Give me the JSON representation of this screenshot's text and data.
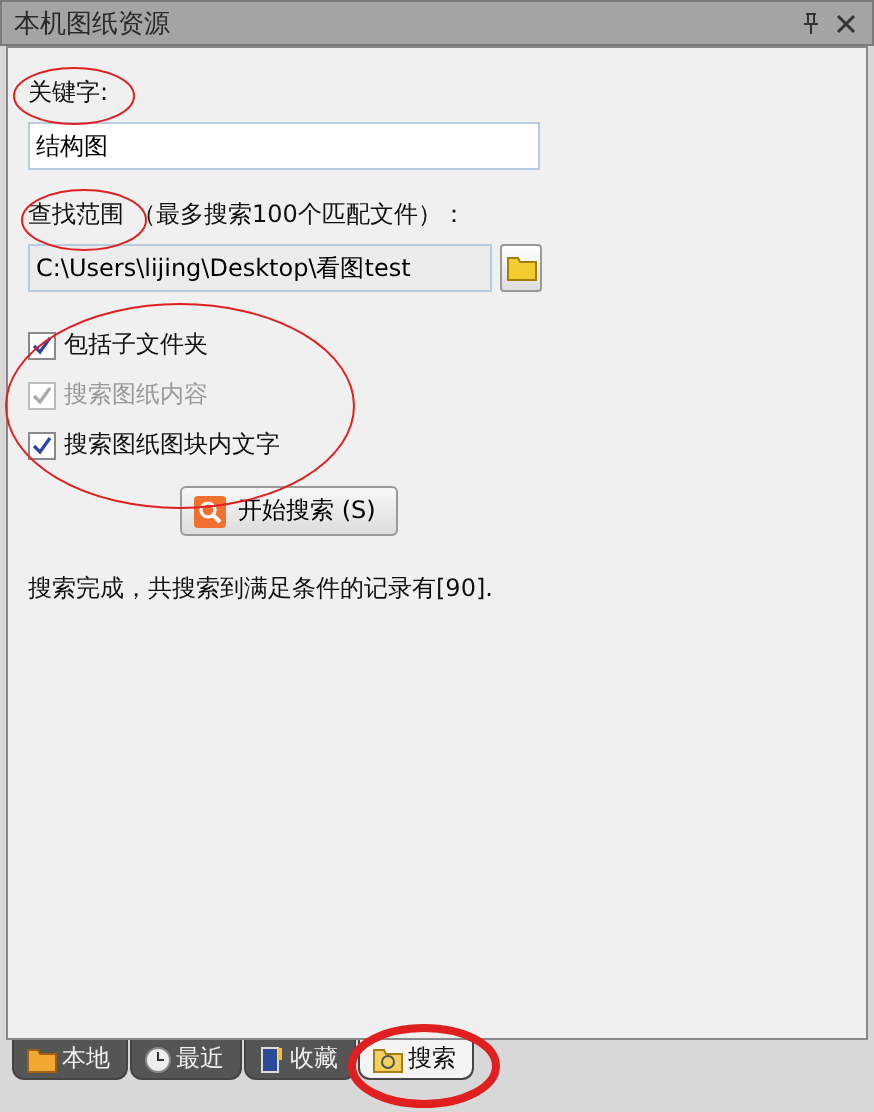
{
  "window": {
    "title": "本机图纸资源"
  },
  "keyword": {
    "label": "关键字:",
    "value": "结构图"
  },
  "scope": {
    "label": "查找范围",
    "hint": "（最多搜索100个匹配文件）：",
    "value": "C:\\Users\\lijing\\Desktop\\看图test"
  },
  "options": [
    {
      "label": "包括子文件夹",
      "checked": true,
      "disabled": false
    },
    {
      "label": "搜索图纸内容",
      "checked": true,
      "disabled": true
    },
    {
      "label": "搜索图纸图块内文字",
      "checked": true,
      "disabled": false
    }
  ],
  "search_button": "开始搜索 (S)",
  "status": "搜索完成，共搜索到满足条件的记录有[90].",
  "tabs": [
    {
      "label": "本地",
      "kind": "local",
      "selected": false
    },
    {
      "label": "最近",
      "kind": "recent",
      "selected": false
    },
    {
      "label": "收藏",
      "kind": "favorites",
      "selected": false
    },
    {
      "label": "搜索",
      "kind": "search",
      "selected": true
    }
  ]
}
